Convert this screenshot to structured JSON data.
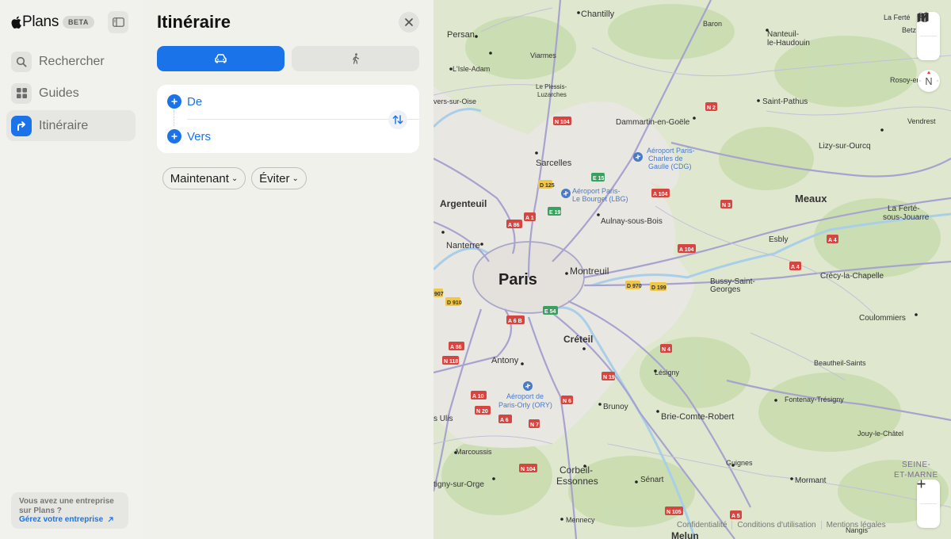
{
  "app": {
    "name": "Plans",
    "badge": "BETA"
  },
  "sidebar": {
    "items": [
      {
        "label": "Rechercher",
        "icon": "search-icon"
      },
      {
        "label": "Guides",
        "icon": "grid-icon"
      },
      {
        "label": "Itinéraire",
        "icon": "directions-arrow-icon",
        "active": true
      }
    ],
    "business": {
      "text": "Vous avez une entreprise sur Plans ?",
      "link": "Gérez votre entreprise"
    }
  },
  "directions": {
    "title": "Itinéraire",
    "modes": [
      {
        "icon": "car-icon",
        "active": true
      },
      {
        "icon": "walk-icon",
        "active": false
      }
    ],
    "from_label": "De",
    "to_label": "Vers",
    "time_option": "Maintenant",
    "avoid_option": "Éviter"
  },
  "map": {
    "places": {
      "paris": "Paris",
      "chantilly": "Chantilly",
      "persan": "Persan",
      "baron": "Baron",
      "laferte": "La Ferté",
      "betz": "Betz",
      "nanteuil1": "Nanteuil-",
      "nanteuil2": "le-Haudouin",
      "rosoy": "Rosoy-en-Mul",
      "viarmes": "Viarmes",
      "lisle": "L'Isle-Adam",
      "plessis1": "Le Plessis-",
      "plessis2": "Luzarches",
      "versoise": "vers-sur-Oise",
      "dammartin": "Dammartin-en-Goële",
      "saintpathus": "Saint-Pathus",
      "vendrest": "Vendrest",
      "lizy": "Lizy-sur-Ourcq",
      "cdg1": "Aéroport Paris-",
      "cdg2": "Charles de",
      "cdg3": "Gaulle (CDG)",
      "sarcelles": "Sarcelles",
      "lbg1": "Aéroport Paris-",
      "lbg2": "Le Bourget (LBG)",
      "meaux": "Meaux",
      "laferte2a": "La Ferté-",
      "laferte2b": "sous-Jouarre",
      "argenteuil": "Argenteuil",
      "aulnay": "Aulnay-sous-Bois",
      "nanterre": "Nanterre",
      "esbly": "Esbly",
      "montreuil": "Montreuil",
      "bussy1": "Bussy-Saint-",
      "bussy2": "Georges",
      "crecy": "Crécy-la-Chapelle",
      "coulommiers": "Coulommiers",
      "creteil": "Créteil",
      "antony": "Antony",
      "lesigny": "Lésigny",
      "beautheil": "Beautheil-Saints",
      "orly1": "Aéroport de",
      "orly2": "Paris-Orly (ORY)",
      "brunoy": "Brunoy",
      "fontenay": "Fontenay-Trésigny",
      "ulis": "s Ulis",
      "brie": "Brie-Comte-Robert",
      "jouy": "Jouy-le-Châtel",
      "marcoussis": "Marcoussis",
      "guignes": "Guignes",
      "seine1": "SEINE-",
      "seine2": "ET-MARNE",
      "corbeil1": "Corbeil-",
      "corbeil2": "Essonnes",
      "senart": "Sénart",
      "mormant": "Mormant",
      "sainte": "tigny-sur-Orge",
      "mennecy": "Mennecy",
      "melun": "Melun",
      "nangis": "Nangis"
    },
    "roads": [
      "N 2",
      "N 104",
      "E 15",
      "D 125",
      "A 104",
      "E 19",
      "A 1",
      "A 86",
      "N 3",
      "A 104",
      "A 4",
      "A 4",
      "D 970",
      "D 199",
      "907",
      "D 910",
      "E 54",
      "A 6 B",
      "A 86",
      "N 118",
      "N 4",
      "N 19",
      "A 10",
      "N 6",
      "N 20",
      "A 6",
      "N 7",
      "N 104",
      "N 105",
      "A 5"
    ],
    "footer": [
      "Confidentialité",
      "Conditions d'utilisation",
      "Mentions légales"
    ],
    "compass_label": "N"
  }
}
